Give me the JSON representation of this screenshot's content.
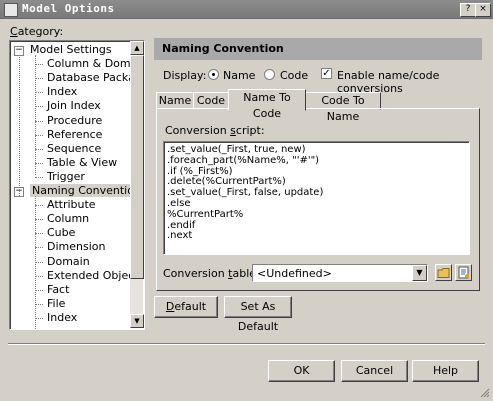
{
  "window": {
    "title": "Model Options",
    "help_glyph": "?",
    "close_glyph": "×"
  },
  "category": {
    "label_prefix": "",
    "label_hotkey": "C",
    "label_rest": "ategory:",
    "tree": [
      {
        "label": "Model Settings",
        "level": 0,
        "expander": "−"
      },
      {
        "label": "Column & Domain",
        "level": 1
      },
      {
        "label": "Database Packag",
        "level": 1
      },
      {
        "label": "Index",
        "level": 1
      },
      {
        "label": "Join Index",
        "level": 1
      },
      {
        "label": "Procedure",
        "level": 1
      },
      {
        "label": "Reference",
        "level": 1
      },
      {
        "label": "Sequence",
        "level": 1
      },
      {
        "label": "Table & View",
        "level": 1
      },
      {
        "label": "Trigger",
        "level": 1
      },
      {
        "label": "Naming Convention",
        "level": 0,
        "expander": "−",
        "selected": true
      },
      {
        "label": "Attribute",
        "level": 1
      },
      {
        "label": "Column",
        "level": 1
      },
      {
        "label": "Cube",
        "level": 1
      },
      {
        "label": "Dimension",
        "level": 1
      },
      {
        "label": "Domain",
        "level": 1
      },
      {
        "label": "Extended Object",
        "level": 1
      },
      {
        "label": "Fact",
        "level": 1
      },
      {
        "label": "File",
        "level": 1
      },
      {
        "label": "Index",
        "level": 1
      }
    ]
  },
  "panel": {
    "header": "Naming Convention",
    "display": {
      "label": "Display:",
      "name_option": "Name",
      "code_option": "Code",
      "selected": "Name",
      "enable_label": "Enable name/code conversions",
      "enable_checked": true,
      "check_glyph": "✓"
    },
    "tabs": [
      {
        "label": "Name",
        "active": false
      },
      {
        "label": "Code",
        "active": false
      },
      {
        "label": "Name To Code",
        "active": true
      },
      {
        "label": "Code To Name",
        "active": false
      }
    ],
    "script": {
      "label_prefix": "Conversion ",
      "label_hotkey": "s",
      "label_rest": "cript:",
      "lines": [
        ".set_value(_First, true, new)",
        ".foreach_part(%Name%, \"'#'\")",
        ".if (%_First%)",
        ".delete(%CurrentPart%)",
        ".set_value(_First, false, update)",
        ".else",
        "%CurrentPart%",
        ".endif",
        ".next"
      ]
    },
    "conversion_table": {
      "label_prefix": "Conversion ",
      "label_hotkey": "t",
      "label_rest": "able:",
      "value": "<Undefined>",
      "dropdown_glyph": "▼"
    }
  },
  "buttons": {
    "default": "Default",
    "default_hotkey": "D",
    "set_as_default": "Set As Default",
    "ok": "OK",
    "cancel": "Cancel",
    "help": "Help"
  },
  "colors": {
    "window_bg": "#d4d0c8",
    "titlebar": "#808080",
    "panel_header": "#a9a9a9"
  }
}
